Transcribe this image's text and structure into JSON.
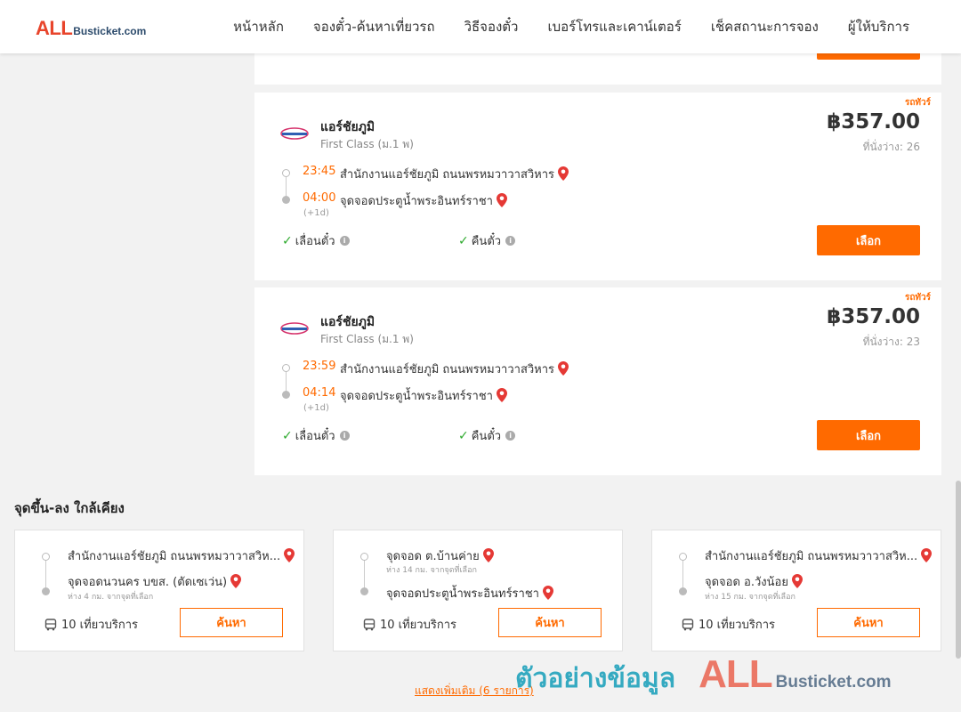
{
  "header": {
    "logo_all": "ALL",
    "logo_rest": "Busticket.com",
    "nav": [
      "หน้าหลัก",
      "จองตั๋ว-ค้นหาเที่ยวรถ",
      "วิธีจองตั๋ว",
      "เบอร์โทรและเคาน์เตอร์",
      "เช็คสถานะการจอง",
      "ผู้ให้บริการ"
    ]
  },
  "trips": [
    {
      "tag": "รถทัวร์",
      "operator": "แอร์ชัยภูมิ",
      "class": "First Class (ม.1 พ)",
      "price": "฿357.00",
      "seats": "ที่นั่งว่าง: 26",
      "depart_time": "23:45",
      "depart_stop": "สำนักงานแอร์ชัยภูมิ ถนนพรหมวาวาสวิหาร",
      "arrive_time": "04:00",
      "arrive_stop": "จุดจอดประตูน้ำพระอินทร์ราชา",
      "plus_day": "(+1d)",
      "feature1": "เลื่อนตั๋ว",
      "feature2": "คืนตั๋ว",
      "select_label": "เลือก"
    },
    {
      "tag": "รถทัวร์",
      "operator": "แอร์ชัยภูมิ",
      "class": "First Class (ม.1 พ)",
      "price": "฿357.00",
      "seats": "ที่นั่งว่าง: 23",
      "depart_time": "23:59",
      "depart_stop": "สำนักงานแอร์ชัยภูมิ ถนนพรหมวาวาสวิหาร",
      "arrive_time": "04:14",
      "arrive_stop": "จุดจอดประตูน้ำพระอินทร์ราชา",
      "plus_day": "(+1d)",
      "feature1": "เลื่อนตั๋ว",
      "feature2": "คืนตั๋ว",
      "select_label": "เลือก"
    }
  ],
  "nearby": {
    "title": "จุดขึ้น-ลง ใกล้เคียง",
    "cards": [
      {
        "stop1": "สำนักงานแอร์ชัยภูมิ ถนนพรหมวาวาสวิห...",
        "dist1": "",
        "stop2": "จุดจอดนวนคร บขส. (ตัดเซเว่น)",
        "dist2": "ห่าง 4 กม. จากจุดที่เลือก",
        "trips": "10 เที่ยวบริการ",
        "search_label": "ค้นหา"
      },
      {
        "stop1": "จุดจอด ต.บ้านค่าย",
        "dist1": "ห่าง 14 กม. จากจุดที่เลือก",
        "stop2": "จุดจอดประตูน้ำพระอินทร์ราชา",
        "dist2": "",
        "trips": "10 เที่ยวบริการ",
        "search_label": "ค้นหา"
      },
      {
        "stop1": "สำนักงานแอร์ชัยภูมิ ถนนพรหมวาวาสวิห...",
        "dist1": "",
        "stop2": "จุดจอด อ.วังน้อย",
        "dist2": "ห่าง 15 กม. จากจุดที่เลือก",
        "trips": "10 เที่ยวบริการ",
        "search_label": "ค้นหา"
      }
    ],
    "show_more": "แสดงเพิ่มเติม (6 รายการ)"
  },
  "watermark": {
    "text": "ตัวอย่างข้อมูล",
    "logo_all": "ALL",
    "logo_rest": "Busticket.com"
  },
  "colors": {
    "accent": "#ff6a00",
    "logo_red": "#e8452c",
    "logo_navy": "#2b4a6b",
    "check_green": "#2eaa2e",
    "pin_red": "#e53935"
  }
}
